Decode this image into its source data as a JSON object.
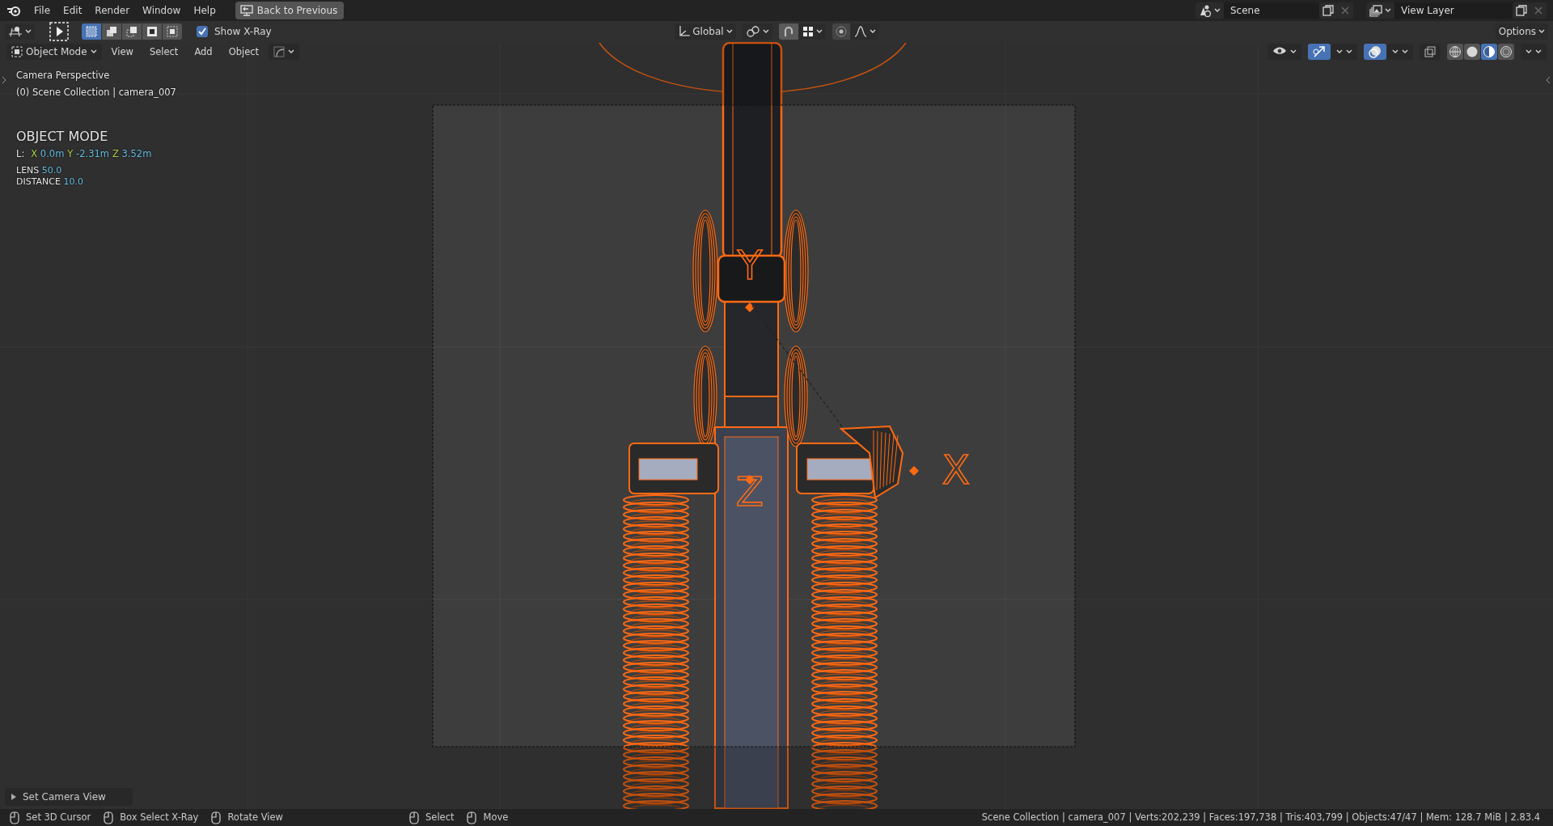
{
  "menu": [
    {
      "label": "File"
    },
    {
      "label": "Edit"
    },
    {
      "label": "Render"
    },
    {
      "label": "Window"
    },
    {
      "label": "Help"
    }
  ],
  "back_button": "Back to Previous",
  "scene": "Scene",
  "view_layer": "View Layer",
  "tool_header": {
    "select_modes": [
      {
        "selected": true
      },
      {
        "selected": false
      },
      {
        "selected": false
      },
      {
        "selected": false
      },
      {
        "selected": false
      }
    ],
    "xray": {
      "label": "Show X-Ray",
      "checked": true
    },
    "orientation": "Global",
    "options": "Options"
  },
  "view_header": {
    "mode": "Object Mode",
    "menus": [
      "View",
      "Select",
      "Add",
      "Object"
    ],
    "gizmos": {
      "on": true
    },
    "overlays": {
      "on": true
    },
    "shading": [
      {
        "selected": false
      },
      {
        "selected": false
      },
      {
        "selected": true
      },
      {
        "selected": false
      }
    ]
  },
  "overlay": {
    "view_name": "Camera Perspective",
    "collection": "(0) Scene Collection | camera_007",
    "mode": "OBJECT MODE",
    "location_label": "L:",
    "location": [
      {
        "axis": "X",
        "value": "0.0m"
      },
      {
        "axis": "Y",
        "value": "-2.31m"
      },
      {
        "axis": "Z",
        "value": "3.52m"
      }
    ],
    "lens": {
      "label": "LENS",
      "value": "50.0"
    },
    "distance": {
      "label": "DISTANCE",
      "value": "10.0"
    }
  },
  "axis_labels": [
    "Y",
    "Z",
    "X"
  ],
  "last_operator": "Set Camera View",
  "status_bar": {
    "hints": [
      {
        "label": "Set 3D Cursor"
      },
      {
        "label": "Box Select X-Ray"
      },
      {
        "label": "Rotate View"
      }
    ],
    "tools": [
      {
        "label": "Select"
      },
      {
        "label": "Move"
      }
    ],
    "stats": "Scene Collection | camera_007 | Verts:202,239 | Faces:197,738 | Tris:403,799 | Objects:47/47 | Mem: 128.7 MiB | 2.83.4"
  }
}
